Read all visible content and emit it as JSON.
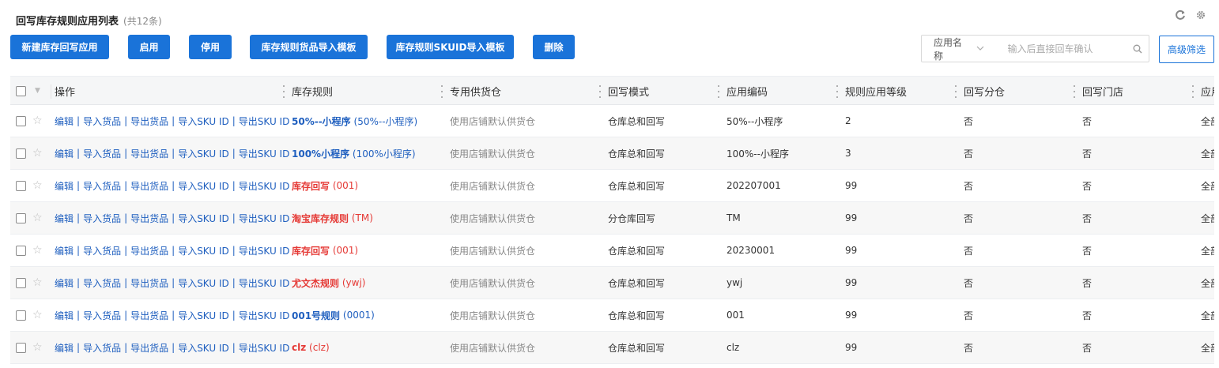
{
  "header": {
    "title": "回写库存规则应用列表",
    "count": "(共12条)"
  },
  "icons": {
    "refresh": "refresh-icon",
    "settings": "gear-icon"
  },
  "toolbar": {
    "new_label": "新建库存回写应用",
    "enable_label": "启用",
    "disable_label": "停用",
    "import_goods_tpl_label": "库存规则货品导入模板",
    "import_sku_tpl_label": "库存规则SKUID导入模板",
    "delete_label": "删除"
  },
  "search": {
    "field_label": "应用名称",
    "placeholder": "输入后直接回车确认",
    "advanced_label": "高级筛选"
  },
  "columns": [
    "操作",
    "库存规则",
    "专用供货仓",
    "回写模式",
    "应用编码",
    "规则应用等级",
    "回写分仓",
    "回写门店",
    "应用"
  ],
  "ops": {
    "edit": "编辑",
    "import_goods": "导入货品",
    "export_goods": "导出货品",
    "import_sku": "导入SKU ID",
    "export_sku": "导出SKU ID",
    "sep": "|"
  },
  "colors": {
    "primary": "#1a73d9",
    "link": "#1f5fbf",
    "danger": "#e53935"
  },
  "rows": [
    {
      "rule_name": "50%--小程序",
      "rule_code": "(50%--小程序)",
      "rule_color": "blue",
      "warehouse": "使用店铺默认供货仓",
      "mode": "仓库总和回写",
      "app_code": "50%--小程序",
      "level": "2",
      "branch": "否",
      "store": "否",
      "scope": "全部"
    },
    {
      "rule_name": "100%小程序",
      "rule_code": "(100%小程序)",
      "rule_color": "blue",
      "warehouse": "使用店铺默认供货仓",
      "mode": "仓库总和回写",
      "app_code": "100%--小程序",
      "level": "3",
      "branch": "否",
      "store": "否",
      "scope": "全部"
    },
    {
      "rule_name": "库存回写",
      "rule_code": "(001)",
      "rule_color": "red",
      "warehouse": "使用店铺默认供货仓",
      "mode": "仓库总和回写",
      "app_code": "202207001",
      "level": "99",
      "branch": "否",
      "store": "否",
      "scope": "全部"
    },
    {
      "rule_name": "淘宝库存规则",
      "rule_code": "(TM)",
      "rule_color": "red",
      "warehouse": "使用店铺默认供货仓",
      "mode": "分仓库回写",
      "app_code": "TM",
      "level": "99",
      "branch": "否",
      "store": "否",
      "scope": "全部"
    },
    {
      "rule_name": "库存回写",
      "rule_code": "(001)",
      "rule_color": "red",
      "warehouse": "使用店铺默认供货仓",
      "mode": "仓库总和回写",
      "app_code": "20230001",
      "level": "99",
      "branch": "否",
      "store": "否",
      "scope": "全部"
    },
    {
      "rule_name": "尤文杰规则",
      "rule_code": "(ywj)",
      "rule_color": "red",
      "warehouse": "使用店铺默认供货仓",
      "mode": "仓库总和回写",
      "app_code": "ywj",
      "level": "99",
      "branch": "否",
      "store": "否",
      "scope": "全部"
    },
    {
      "rule_name": "001号规则",
      "rule_code": "(0001)",
      "rule_color": "blue",
      "warehouse": "使用店铺默认供货仓",
      "mode": "仓库总和回写",
      "app_code": "001",
      "level": "99",
      "branch": "否",
      "store": "否",
      "scope": "全部"
    },
    {
      "rule_name": "clz",
      "rule_code": "(clz)",
      "rule_color": "red",
      "warehouse": "使用店铺默认供货仓",
      "mode": "仓库总和回写",
      "app_code": "clz",
      "level": "99",
      "branch": "否",
      "store": "否",
      "scope": "全部"
    }
  ]
}
